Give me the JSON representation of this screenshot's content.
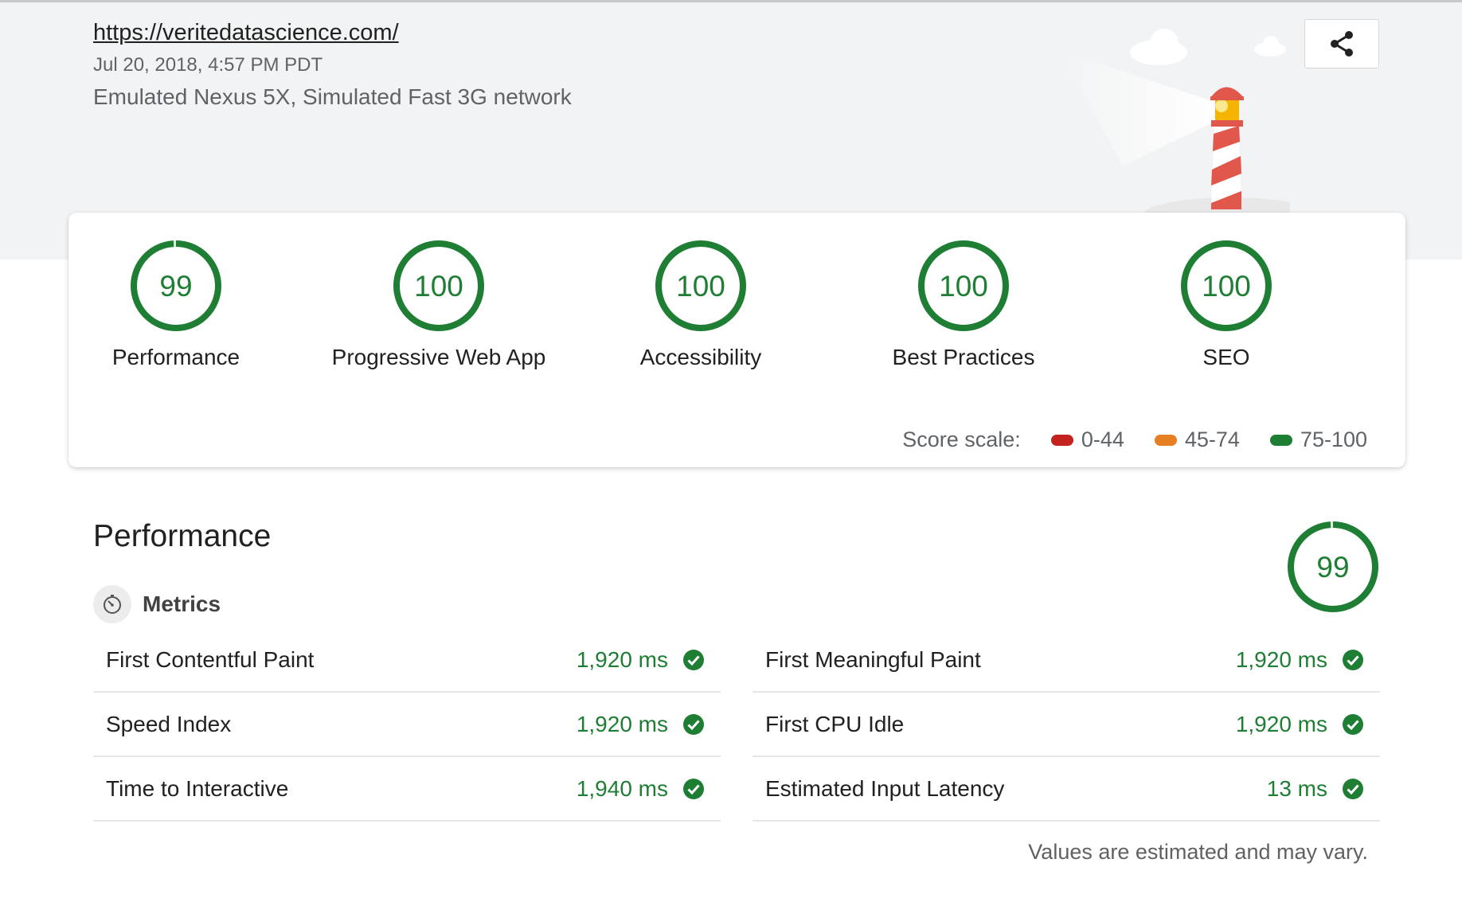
{
  "header": {
    "url": "https://veritedatascience.com/",
    "date": "Jul 20, 2018, 4:57 PM PDT",
    "environment": "Emulated Nexus 5X, Simulated Fast 3G network",
    "share_icon": "share-icon"
  },
  "summary": {
    "gauges": [
      {
        "score": "99",
        "label": "Performance",
        "value": 0.99
      },
      {
        "score": "100",
        "label": "Progressive Web App",
        "value": 1.0
      },
      {
        "score": "100",
        "label": "Accessibility",
        "value": 1.0
      },
      {
        "score": "100",
        "label": "Best Practices",
        "value": 1.0
      },
      {
        "score": "100",
        "label": "SEO",
        "value": 1.0
      }
    ],
    "scale": {
      "label": "Score scale:",
      "ranges": [
        {
          "label": "0-44",
          "color": "#c5221f"
        },
        {
          "label": "45-74",
          "color": "#e67e22"
        },
        {
          "label": "75-100",
          "color": "#1e7e34"
        }
      ]
    }
  },
  "performance": {
    "title": "Performance",
    "score": "99",
    "score_value": 0.99,
    "metrics_label": "Metrics",
    "metrics_icon": "stopwatch-icon",
    "left_metrics": [
      {
        "name": "First Contentful Paint",
        "value": "1,920 ms"
      },
      {
        "name": "Speed Index",
        "value": "1,920 ms"
      },
      {
        "name": "Time to Interactive",
        "value": "1,940 ms"
      }
    ],
    "right_metrics": [
      {
        "name": "First Meaningful Paint",
        "value": "1,920 ms"
      },
      {
        "name": "First CPU Idle",
        "value": "1,920 ms"
      },
      {
        "name": "Estimated Input Latency",
        "value": "13 ms"
      }
    ],
    "footnote": "Values are estimated and may vary."
  },
  "colors": {
    "pass": "#1e7e34",
    "pass_ring_bg": "#e0efe2"
  }
}
